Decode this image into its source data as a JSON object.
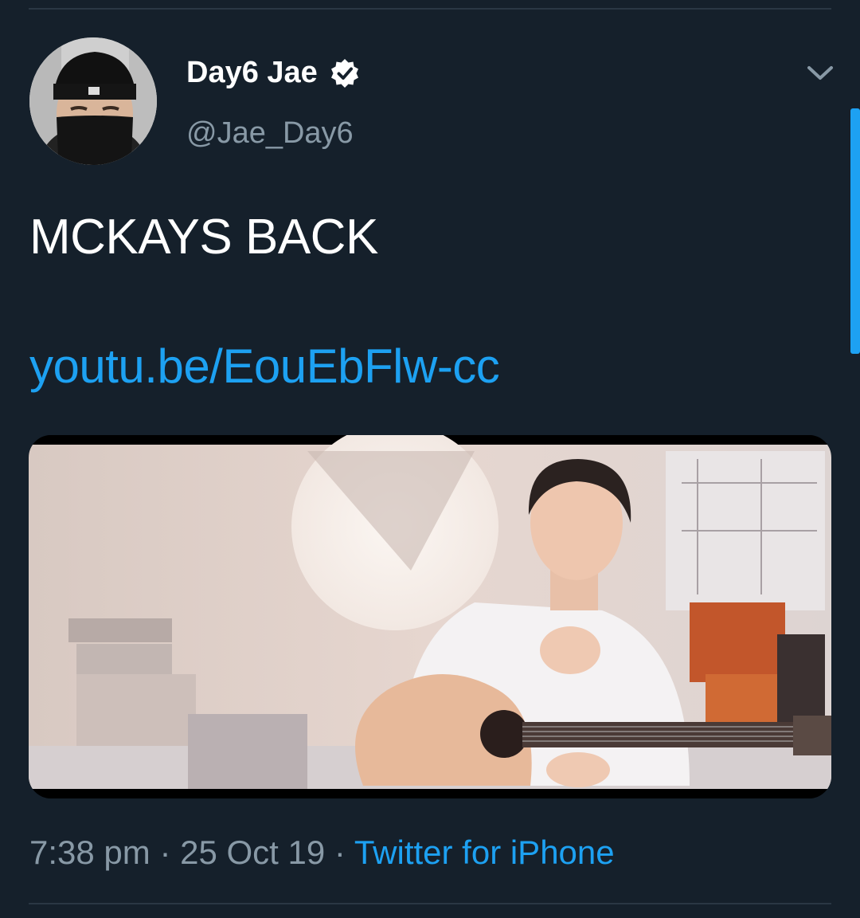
{
  "tweet": {
    "author": {
      "display_name": "Day6 Jae",
      "handle": "@Jae_Day6",
      "verified": true
    },
    "text": "MCKAYS BACK",
    "link": "youtu.be/EouEbFlw-cc",
    "media": {
      "type": "video-thumbnail"
    },
    "meta": {
      "time": "7:38 pm",
      "separator": "·",
      "date": "25 Oct 19",
      "source": "Twitter for iPhone"
    }
  },
  "icons": {
    "verified": "verified-badge-icon",
    "more": "chevron-down-icon"
  },
  "colors": {
    "background": "#15202b",
    "link": "#1da1f2",
    "secondary_text": "#8899a6"
  }
}
